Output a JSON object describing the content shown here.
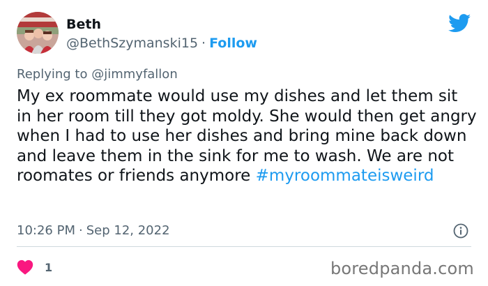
{
  "author": {
    "display_name": "Beth",
    "handle": "@BethSzymanski15",
    "separator": "·",
    "follow_label": "Follow"
  },
  "reply": {
    "prefix": "Replying to",
    "mention": "@jimmyfallon"
  },
  "tweet": {
    "text": "My ex roommate would use my dishes and let them sit in her room till they got moldy. She would then get angry when I had to use her dishes and bring mine back down and leave them in the sink for me to wash. We are not roomates or friends anymore ",
    "hashtag": "#myroommateisweird",
    "time": "10:26 PM",
    "separator": "·",
    "date": "Sep 12, 2022"
  },
  "engagement": {
    "likes": "1"
  },
  "watermark": "boredpanda.com",
  "icons": {
    "brand": "twitter-bird-icon",
    "info": "info-icon",
    "like": "heart-icon"
  },
  "colors": {
    "accent": "#1d9bf0",
    "heart": "#f91880",
    "secondary_text": "#536471",
    "primary_text": "#0f1419",
    "divider": "#cfd9de",
    "watermark": "#777777"
  }
}
